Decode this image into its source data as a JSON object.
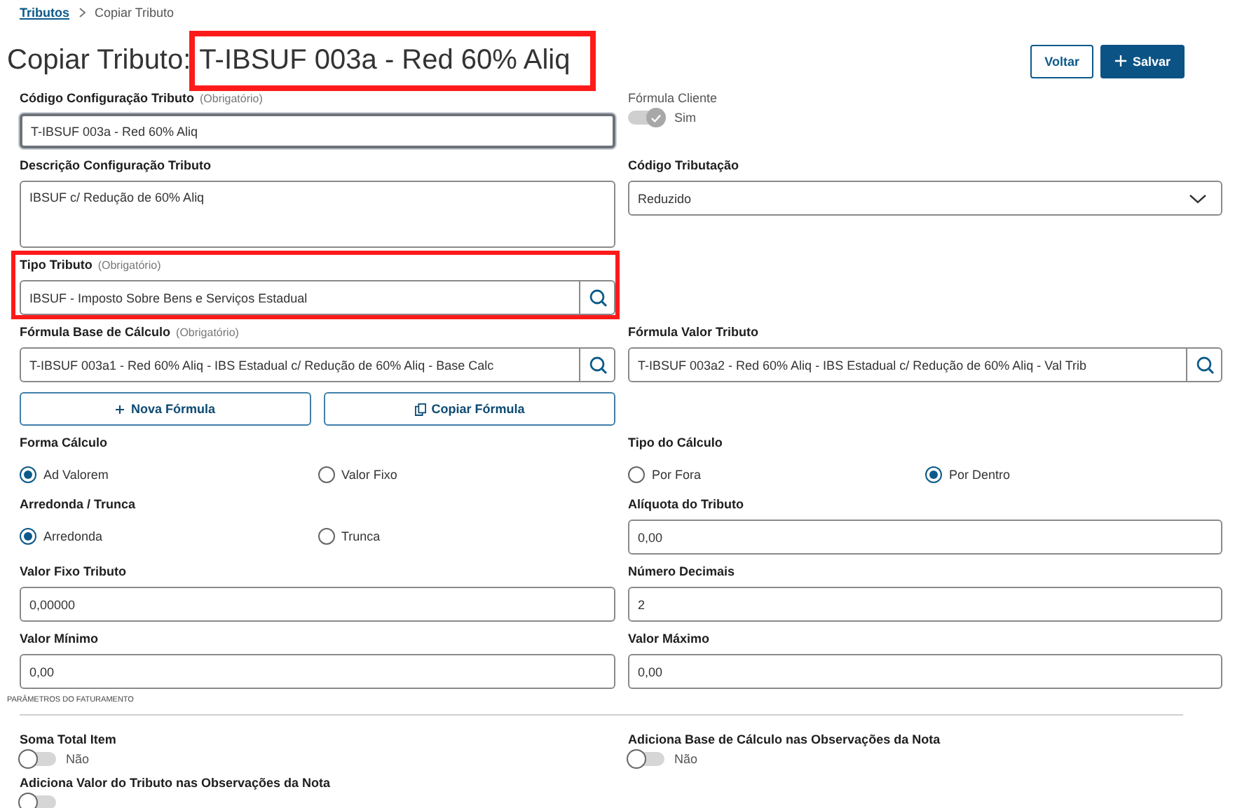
{
  "breadcrumb": [
    {
      "label": "Tributos",
      "kind": "link"
    },
    {
      "label": "Copiar Tributo",
      "kind": "current"
    }
  ],
  "header": {
    "title": "Copiar Tributo:",
    "record": "T-IBSUF 003a - Red 60% Aliq",
    "record_highlighted": true
  },
  "actions": [
    {
      "label": "Voltar",
      "kind": "secondary"
    },
    {
      "label": "Salvar",
      "kind": "primary"
    }
  ],
  "rows": [
    {
      "left": {
        "kind": "text",
        "label": "Código Configuração Tributo",
        "hint": "(Obrigatório)",
        "value": "T-IBSUF 003a - Red 60% Aliq",
        "focused": true
      },
      "right": {
        "kind": "toggle",
        "label": "Fórmula Cliente",
        "on": true,
        "disabled": true,
        "state_label": "Sim"
      }
    },
    {
      "left": {
        "kind": "textarea",
        "label": "Descrição Configuração Tributo",
        "value": "IBSUF c/ Redução de 60% Aliq"
      },
      "right": {
        "kind": "select",
        "label": "Código Tributação",
        "value": "Reduzido"
      }
    },
    {
      "left": {
        "kind": "lookup",
        "label": "Tipo Tributo",
        "hint": "(Obrigatório)",
        "value": "IBSUF - Imposto Sobre Bens e Serviços Estadual",
        "highlighted": true
      }
    },
    {
      "left": {
        "kind": "lookup",
        "label": "Fórmula Base de Cálculo",
        "hint": "(Obrigatório)",
        "value": "T-IBSUF 003a1 - Red 60% Aliq - IBS Estadual c/ Redução de 60% Aliq - Base Calc"
      },
      "right": {
        "kind": "lookup",
        "label": "Fórmula Valor Tributo",
        "value": "T-IBSUF 003a2 - Red 60% Aliq - IBS Estadual c/ Redução de 60% Aliq - Val Trib"
      }
    },
    {
      "left": {
        "kind": "buttons",
        "buttons": [
          {
            "label": "Nova Fórmula",
            "kind": "add"
          },
          {
            "label": "Copiar Fórmula",
            "kind": "copy"
          }
        ]
      }
    },
    {
      "left": {
        "kind": "radio",
        "label": "Forma Cálculo",
        "options": [
          {
            "label": "Ad Valorem",
            "selected": true
          },
          {
            "label": "Valor Fixo",
            "selected": false
          }
        ]
      },
      "right": {
        "kind": "radio",
        "label": "Tipo do Cálculo",
        "options": [
          {
            "label": "Por Fora",
            "selected": false
          },
          {
            "label": "Por Dentro",
            "selected": true
          }
        ]
      }
    },
    {
      "left": {
        "kind": "radio",
        "label": "Arredonda / Trunca",
        "options": [
          {
            "label": "Arredonda",
            "selected": true
          },
          {
            "label": "Trunca",
            "selected": false
          }
        ]
      },
      "right": {
        "kind": "text",
        "label": "Alíquota do Tributo",
        "value": "0,00"
      }
    },
    {
      "left": {
        "kind": "text",
        "label": "Valor Fixo Tributo",
        "value": "0,00000"
      },
      "right": {
        "kind": "text",
        "label": "Número Decimais",
        "value": "2"
      }
    },
    {
      "left": {
        "kind": "text",
        "label": "Valor Mínimo",
        "value": "0,00"
      },
      "right": {
        "kind": "text",
        "label": "Valor Máximo",
        "value": "0,00"
      }
    }
  ],
  "section": {
    "title": "PARÂMETROS DO FATURAMENTO"
  },
  "billing_rows": [
    {
      "left": {
        "kind": "toggle",
        "label": "Soma Total Item",
        "on": false,
        "state_label": "Não"
      },
      "right": {
        "kind": "toggle",
        "label": "Adiciona Base de Cálculo nas Observações da Nota",
        "on": false,
        "state_label": "Não"
      }
    },
    {
      "left": {
        "kind": "toggle",
        "label": "Adiciona Valor do Tributo nas Observações da Nota",
        "on": false
      }
    }
  ]
}
